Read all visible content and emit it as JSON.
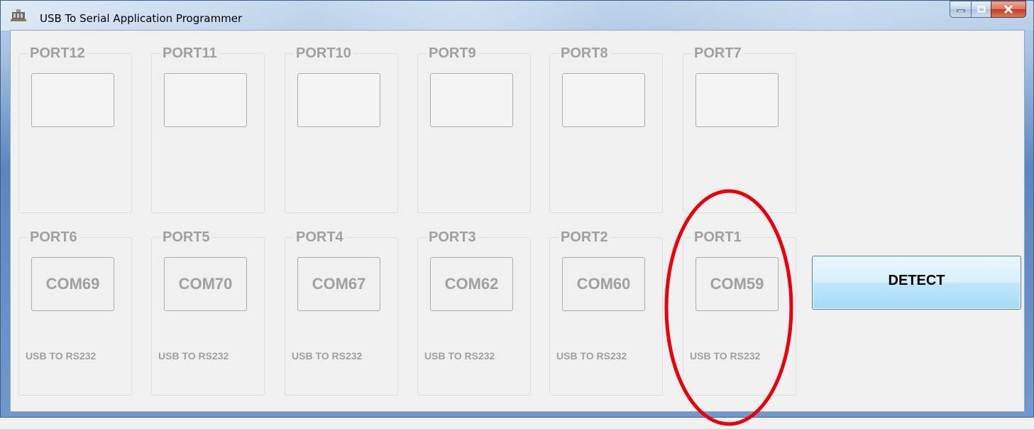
{
  "window": {
    "title": "USB To Serial Application Programmer"
  },
  "top_row": [
    {
      "port": "PORT12",
      "com": ""
    },
    {
      "port": "PORT11",
      "com": ""
    },
    {
      "port": "PORT10",
      "com": ""
    },
    {
      "port": "PORT9",
      "com": ""
    },
    {
      "port": "PORT8",
      "com": ""
    },
    {
      "port": "PORT7",
      "com": ""
    }
  ],
  "bottom_row": [
    {
      "port": "PORT6",
      "com": "COM69",
      "desc": "USB TO RS232"
    },
    {
      "port": "PORT5",
      "com": "COM70",
      "desc": "USB TO RS232"
    },
    {
      "port": "PORT4",
      "com": "COM67",
      "desc": "USB TO RS232"
    },
    {
      "port": "PORT3",
      "com": "COM62",
      "desc": "USB TO RS232"
    },
    {
      "port": "PORT2",
      "com": "COM60",
      "desc": "USB TO RS232"
    },
    {
      "port": "PORT1",
      "com": "COM59",
      "desc": "USB TO RS232"
    }
  ],
  "detect_button": {
    "label": "DETECT"
  },
  "colors": {
    "disabled_text": "#a0a0a0",
    "annotation": "#e8000b"
  },
  "icons": [
    "app-icon",
    "minimize-icon",
    "maximize-icon",
    "close-icon"
  ]
}
